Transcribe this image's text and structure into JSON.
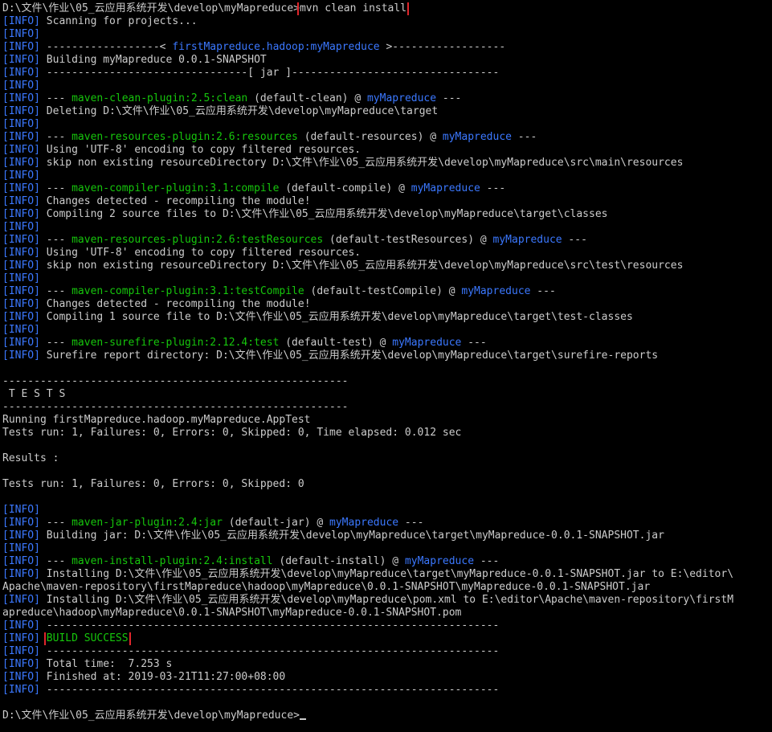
{
  "colors": {
    "background": "#000000",
    "text": "#cccccc",
    "info_tag": "#3b78ff",
    "plugin": "#16c60c",
    "project": "#3b78ff",
    "build_success": "#16c60c",
    "highlight_box": "#e0262b"
  },
  "terminal": {
    "prompt_path": "D:\\文件\\作业\\05_云应用系统开发\\develop\\myMapreduce>",
    "command": "mvn clean install",
    "lines": [
      [
        {
          "t": "D:\\文件\\作业\\05_云应用系统开发\\develop\\myMapreduce>"
        },
        {
          "t": "mvn clean install",
          "c": "hl",
          "name": "command-highlight"
        }
      ],
      [
        {
          "t": "[INFO]",
          "c": "info"
        },
        {
          "t": " Scanning for projects..."
        }
      ],
      [
        {
          "t": "[INFO]",
          "c": "info"
        }
      ],
      [
        {
          "t": "[INFO]",
          "c": "info"
        },
        {
          "t": " ------------------< "
        },
        {
          "t": "firstMapreduce.hadoop:myMapreduce",
          "c": "project"
        },
        {
          "t": " >------------------"
        }
      ],
      [
        {
          "t": "[INFO]",
          "c": "info"
        },
        {
          "t": " Building myMapreduce 0.0.1-SNAPSHOT"
        }
      ],
      [
        {
          "t": "[INFO]",
          "c": "info"
        },
        {
          "t": " --------------------------------[ jar ]---------------------------------"
        }
      ],
      [
        {
          "t": "[INFO]",
          "c": "info"
        }
      ],
      [
        {
          "t": "[INFO]",
          "c": "info"
        },
        {
          "t": " --- "
        },
        {
          "t": "maven-clean-plugin:2.5:clean",
          "c": "plugin"
        },
        {
          "t": " (default-clean) @ "
        },
        {
          "t": "myMapreduce",
          "c": "project"
        },
        {
          "t": " ---"
        }
      ],
      [
        {
          "t": "[INFO]",
          "c": "info"
        },
        {
          "t": " Deleting D:\\文件\\作业\\05_云应用系统开发\\develop\\myMapreduce\\target"
        }
      ],
      [
        {
          "t": "[INFO]",
          "c": "info"
        }
      ],
      [
        {
          "t": "[INFO]",
          "c": "info"
        },
        {
          "t": " --- "
        },
        {
          "t": "maven-resources-plugin:2.6:resources",
          "c": "plugin"
        },
        {
          "t": " (default-resources) @ "
        },
        {
          "t": "myMapreduce",
          "c": "project"
        },
        {
          "t": " ---"
        }
      ],
      [
        {
          "t": "[INFO]",
          "c": "info"
        },
        {
          "t": " Using 'UTF-8' encoding to copy filtered resources."
        }
      ],
      [
        {
          "t": "[INFO]",
          "c": "info"
        },
        {
          "t": " skip non existing resourceDirectory D:\\文件\\作业\\05_云应用系统开发\\develop\\myMapreduce\\src\\main\\resources"
        }
      ],
      [
        {
          "t": "[INFO]",
          "c": "info"
        }
      ],
      [
        {
          "t": "[INFO]",
          "c": "info"
        },
        {
          "t": " --- "
        },
        {
          "t": "maven-compiler-plugin:3.1:compile",
          "c": "plugin"
        },
        {
          "t": " (default-compile) @ "
        },
        {
          "t": "myMapreduce",
          "c": "project"
        },
        {
          "t": " ---"
        }
      ],
      [
        {
          "t": "[INFO]",
          "c": "info"
        },
        {
          "t": " Changes detected - recompiling the module!"
        }
      ],
      [
        {
          "t": "[INFO]",
          "c": "info"
        },
        {
          "t": " Compiling 2 source files to D:\\文件\\作业\\05_云应用系统开发\\develop\\myMapreduce\\target\\classes"
        }
      ],
      [
        {
          "t": "[INFO]",
          "c": "info"
        }
      ],
      [
        {
          "t": "[INFO]",
          "c": "info"
        },
        {
          "t": " --- "
        },
        {
          "t": "maven-resources-plugin:2.6:testResources",
          "c": "plugin"
        },
        {
          "t": " (default-testResources) @ "
        },
        {
          "t": "myMapreduce",
          "c": "project"
        },
        {
          "t": " ---"
        }
      ],
      [
        {
          "t": "[INFO]",
          "c": "info"
        },
        {
          "t": " Using 'UTF-8' encoding to copy filtered resources."
        }
      ],
      [
        {
          "t": "[INFO]",
          "c": "info"
        },
        {
          "t": " skip non existing resourceDirectory D:\\文件\\作业\\05_云应用系统开发\\develop\\myMapreduce\\src\\test\\resources"
        }
      ],
      [
        {
          "t": "[INFO]",
          "c": "info"
        }
      ],
      [
        {
          "t": "[INFO]",
          "c": "info"
        },
        {
          "t": " --- "
        },
        {
          "t": "maven-compiler-plugin:3.1:testCompile",
          "c": "plugin"
        },
        {
          "t": " (default-testCompile) @ "
        },
        {
          "t": "myMapreduce",
          "c": "project"
        },
        {
          "t": " ---"
        }
      ],
      [
        {
          "t": "[INFO]",
          "c": "info"
        },
        {
          "t": " Changes detected - recompiling the module!"
        }
      ],
      [
        {
          "t": "[INFO]",
          "c": "info"
        },
        {
          "t": " Compiling 1 source file to D:\\文件\\作业\\05_云应用系统开发\\develop\\myMapreduce\\target\\test-classes"
        }
      ],
      [
        {
          "t": "[INFO]",
          "c": "info"
        }
      ],
      [
        {
          "t": "[INFO]",
          "c": "info"
        },
        {
          "t": " --- "
        },
        {
          "t": "maven-surefire-plugin:2.12.4:test",
          "c": "plugin"
        },
        {
          "t": " (default-test) @ "
        },
        {
          "t": "myMapreduce",
          "c": "project"
        },
        {
          "t": " ---"
        }
      ],
      [
        {
          "t": "[INFO]",
          "c": "info"
        },
        {
          "t": " Surefire report directory: D:\\文件\\作业\\05_云应用系统开发\\develop\\myMapreduce\\target\\surefire-reports"
        }
      ],
      [],
      [
        {
          "t": "-------------------------------------------------------"
        }
      ],
      [
        {
          "t": " T E S T S"
        }
      ],
      [
        {
          "t": "-------------------------------------------------------"
        }
      ],
      [
        {
          "t": "Running firstMapreduce.hadoop.myMapreduce.AppTest"
        }
      ],
      [
        {
          "t": "Tests run: 1, Failures: 0, Errors: 0, Skipped: 0, Time elapsed: 0.012 sec"
        }
      ],
      [],
      [
        {
          "t": "Results :"
        }
      ],
      [],
      [
        {
          "t": "Tests run: 1, Failures: 0, Errors: 0, Skipped: 0"
        }
      ],
      [],
      [
        {
          "t": "[INFO]",
          "c": "info"
        }
      ],
      [
        {
          "t": "[INFO]",
          "c": "info"
        },
        {
          "t": " --- "
        },
        {
          "t": "maven-jar-plugin:2.4:jar",
          "c": "plugin"
        },
        {
          "t": " (default-jar) @ "
        },
        {
          "t": "myMapreduce",
          "c": "project"
        },
        {
          "t": " ---"
        }
      ],
      [
        {
          "t": "[INFO]",
          "c": "info"
        },
        {
          "t": " Building jar: D:\\文件\\作业\\05_云应用系统开发\\develop\\myMapreduce\\target\\myMapreduce-0.0.1-SNAPSHOT.jar"
        }
      ],
      [
        {
          "t": "[INFO]",
          "c": "info"
        }
      ],
      [
        {
          "t": "[INFO]",
          "c": "info"
        },
        {
          "t": " --- "
        },
        {
          "t": "maven-install-plugin:2.4:install",
          "c": "plugin"
        },
        {
          "t": " (default-install) @ "
        },
        {
          "t": "myMapreduce",
          "c": "project"
        },
        {
          "t": " ---"
        }
      ],
      [
        {
          "t": "[INFO]",
          "c": "info"
        },
        {
          "t": " Installing D:\\文件\\作业\\05_云应用系统开发\\develop\\myMapreduce\\target\\myMapreduce-0.0.1-SNAPSHOT.jar to E:\\editor\\"
        }
      ],
      [
        {
          "t": "Apache\\maven-repository\\firstMapreduce\\hadoop\\myMapreduce\\0.0.1-SNAPSHOT\\myMapreduce-0.0.1-SNAPSHOT.jar"
        }
      ],
      [
        {
          "t": "[INFO]",
          "c": "info"
        },
        {
          "t": " Installing D:\\文件\\作业\\05_云应用系统开发\\develop\\myMapreduce\\pom.xml to E:\\editor\\Apache\\maven-repository\\firstM"
        }
      ],
      [
        {
          "t": "apreduce\\hadoop\\myMapreduce\\0.0.1-SNAPSHOT\\myMapreduce-0.0.1-SNAPSHOT.pom"
        }
      ],
      [
        {
          "t": "[INFO]",
          "c": "info"
        },
        {
          "t": " ------------------------------------------------------------------------"
        }
      ],
      [
        {
          "t": "[INFO]",
          "c": "info"
        },
        {
          "t": " "
        },
        {
          "t": "BUILD SUCCESS",
          "c": "success hl",
          "name": "build-success-highlight"
        }
      ],
      [
        {
          "t": "[INFO]",
          "c": "info"
        },
        {
          "t": " ------------------------------------------------------------------------"
        }
      ],
      [
        {
          "t": "[INFO]",
          "c": "info"
        },
        {
          "t": " Total time:  7.253 s"
        }
      ],
      [
        {
          "t": "[INFO]",
          "c": "info"
        },
        {
          "t": " Finished at: 2019-03-21T11:27:00+08:00"
        }
      ],
      [
        {
          "t": "[INFO]",
          "c": "info"
        },
        {
          "t": " ------------------------------------------------------------------------"
        }
      ],
      [],
      [
        {
          "t": "D:\\文件\\作业\\05_云应用系统开发\\develop\\myMapreduce>"
        },
        {
          "cursor": true
        }
      ]
    ]
  }
}
